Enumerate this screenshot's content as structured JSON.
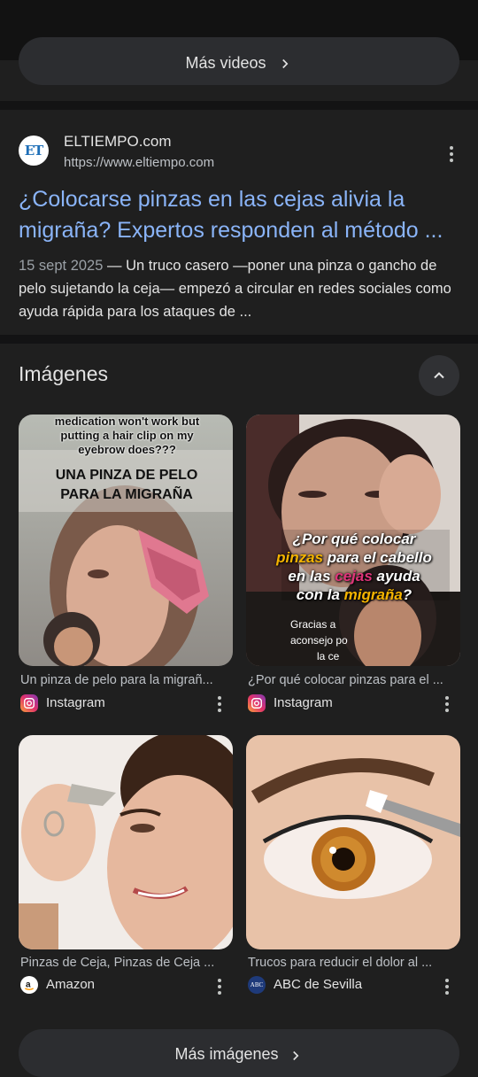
{
  "videos": {
    "more_label": "Más videos"
  },
  "result": {
    "site_name": "ELTIEMPO.com",
    "site_url": "https://www.eltiempo.com",
    "logo_text": "ET",
    "title": "¿Colocarse pinzas en las cejas alivia la migraña? Expertos responden al método ...",
    "date": "15 sept 2025",
    "snippet": " — Un truco casero —poner una pinza o gancho de pelo sujetando la ceja— empezó a circular en redes sociales como ayuda rápida para los ataques de ..."
  },
  "images": {
    "title": "Imágenes",
    "more_label": "Más imágenes",
    "cards": [
      {
        "caption": "Un pinza de pelo para la migrañ...",
        "source": "Instagram",
        "source_icon": "instagram-icon",
        "overlay_top": "medication won't work but putting a hair clip on my eyebrow does???",
        "overlay_main": "UNA PINZA DE PELO PARA LA MIGRAÑA"
      },
      {
        "caption": "¿Por qué colocar pinzas para el ...",
        "source": "Instagram",
        "source_icon": "instagram-icon",
        "overlay_l1": "¿Por qué colocar",
        "overlay_l2a": "pinzas",
        "overlay_l2b": " para el cabello",
        "overlay_l3a": "en las ",
        "overlay_l3b": "cejas",
        "overlay_l3c": " ayuda",
        "overlay_l4a": "con la ",
        "overlay_l4b": "migraña",
        "overlay_l4c": "?",
        "overlay_small1": "Gracias a",
        "overlay_small2": "aconsejo po",
        "overlay_small3": "la ce"
      },
      {
        "caption": "Pinzas de Ceja, Pinzas de Ceja ...",
        "source": "Amazon",
        "source_icon": "amazon-icon"
      },
      {
        "caption": "Trucos para reducir el dolor al ...",
        "source": "ABC de Sevilla",
        "source_icon": "abc-icon",
        "icon_text": "ABC"
      }
    ]
  },
  "colors": {
    "link": "#8ab4f8",
    "background": "#1f1f1f",
    "text": "#e3e3e3",
    "secondary": "#bdc1c6"
  }
}
